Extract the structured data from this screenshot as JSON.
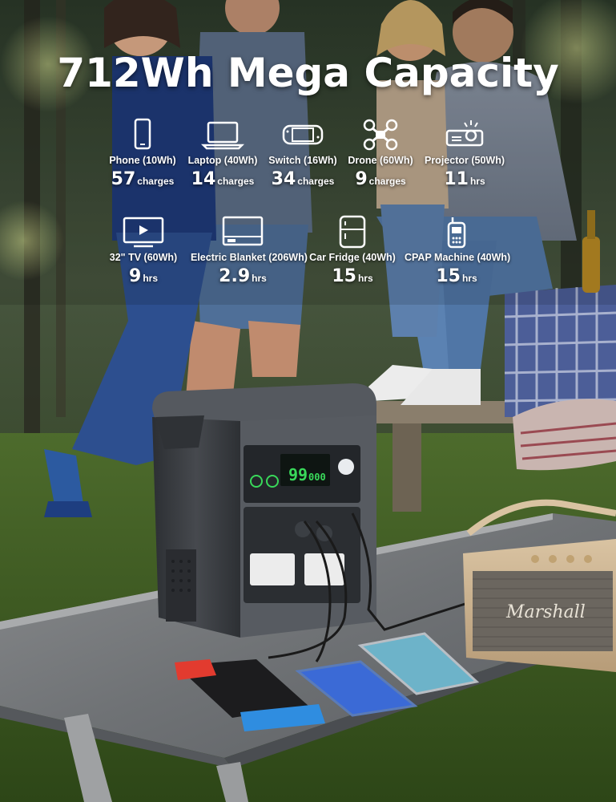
{
  "headline": "712Wh Mega Capacity",
  "devices": [
    {
      "icon": "phone-icon",
      "label": "Phone (10Wh)",
      "value": "57",
      "unit": "charges"
    },
    {
      "icon": "laptop-icon",
      "label": "Laptop (40Wh)",
      "value": "14",
      "unit": "charges"
    },
    {
      "icon": "switch-console-icon",
      "label": "Switch (16Wh)",
      "value": "34",
      "unit": "charges"
    },
    {
      "icon": "drone-icon",
      "label": "Drone (60Wh)",
      "value": "9",
      "unit": "charges"
    },
    {
      "icon": "projector-icon",
      "label": "Projector (50Wh)",
      "value": "11",
      "unit": "hrs"
    },
    {
      "icon": "tv-icon",
      "label": "32\" TV (60Wh)",
      "value": "9",
      "unit": "hrs"
    },
    {
      "icon": "electric-blanket-icon",
      "label": "Electric Blanket (206Wh)",
      "value": "2.9",
      "unit": "hrs"
    },
    {
      "icon": "car-fridge-icon",
      "label": "Car Fridge (40Wh)",
      "value": "15",
      "unit": "hrs"
    },
    {
      "icon": "cpap-machine-icon",
      "label": "CPAP Machine (40Wh)",
      "value": "15",
      "unit": "hrs"
    }
  ],
  "product_display": {
    "readout_a": "99",
    "readout_b": "000"
  },
  "speaker_brand": "Marshall",
  "colors": {
    "text": "#ffffff",
    "lcd": "#39d85a",
    "product_body": "#3c3f44"
  }
}
